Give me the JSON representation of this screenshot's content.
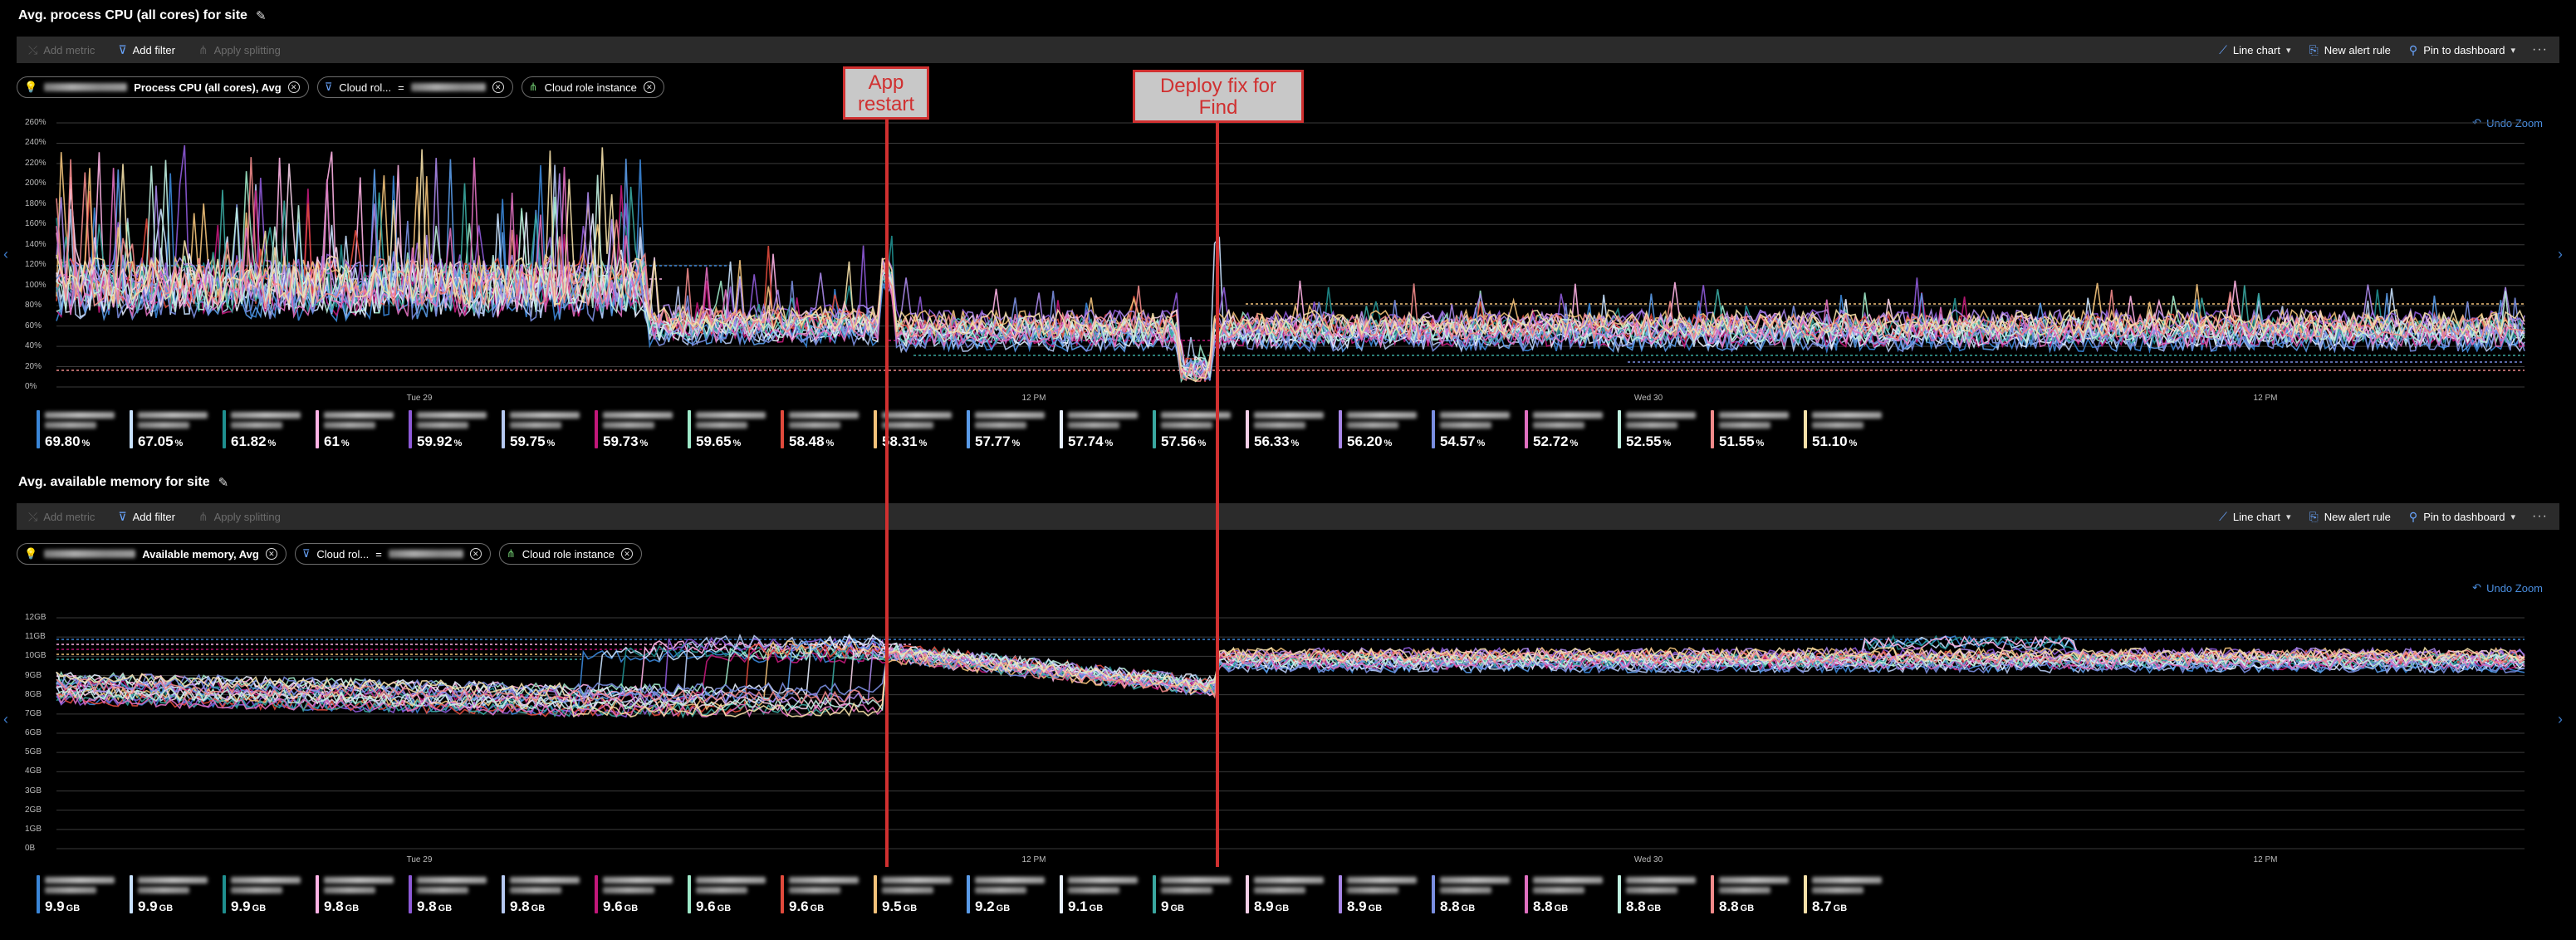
{
  "cpu_panel": {
    "title": "Avg. process CPU (all cores) for site",
    "toolbar": {
      "add_metric": "Add metric",
      "add_filter": "Add filter",
      "apply_splitting": "Apply splitting",
      "line_chart": "Line chart",
      "new_alert_rule": "New alert rule",
      "pin_to_dashboard": "Pin to dashboard",
      "more": "···"
    },
    "chips": {
      "metric_label": "Process CPU (all cores), Avg",
      "filter_label": "Cloud rol...",
      "filter_op": "=",
      "split_label": "Cloud role instance"
    },
    "undo_zoom": "Undo Zoom",
    "y_ticks": [
      "260%",
      "240%",
      "220%",
      "200%",
      "180%",
      "160%",
      "140%",
      "120%",
      "100%",
      "80%",
      "60%",
      "40%",
      "20%",
      "0%"
    ],
    "x_ticks": [
      "Tue 29",
      "12 PM",
      "Wed 30",
      "12 PM"
    ],
    "legend_values": [
      "69.80",
      "67.05",
      "61.82",
      "61",
      "59.92",
      "59.75",
      "59.73",
      "59.65",
      "58.48",
      "58.31",
      "57.77",
      "57.74",
      "57.56",
      "56.33",
      "56.20",
      "54.57",
      "52.72",
      "52.55",
      "51.55",
      "51.10"
    ],
    "legend_unit": "%"
  },
  "mem_panel": {
    "title": "Avg. available memory for site",
    "toolbar": {
      "add_metric": "Add metric",
      "add_filter": "Add filter",
      "apply_splitting": "Apply splitting",
      "line_chart": "Line chart",
      "new_alert_rule": "New alert rule",
      "pin_to_dashboard": "Pin to dashboard",
      "more": "···"
    },
    "chips": {
      "metric_label": "Available memory, Avg",
      "filter_label": "Cloud rol...",
      "filter_op": "=",
      "split_label": "Cloud role instance"
    },
    "undo_zoom": "Undo Zoom",
    "y_ticks": [
      "12GB",
      "11GB",
      "10GB",
      "9GB",
      "8GB",
      "7GB",
      "6GB",
      "5GB",
      "4GB",
      "3GB",
      "2GB",
      "1GB",
      "0B"
    ],
    "x_ticks": [
      "Tue 29",
      "12 PM",
      "Wed 30",
      "12 PM"
    ],
    "legend_values": [
      "9.9",
      "9.9",
      "9.9",
      "9.8",
      "9.8",
      "9.8",
      "9.6",
      "9.6",
      "9.6",
      "9.5",
      "9.2",
      "9.1",
      "9",
      "8.9",
      "8.9",
      "8.8",
      "8.8",
      "8.8",
      "8.8",
      "8.7"
    ],
    "legend_unit": "GB"
  },
  "series_colors": [
    "#3a86d8",
    "#c9e2ff",
    "#1f8f8f",
    "#ffb3e6",
    "#8e5ad8",
    "#b5c8f0",
    "#c2187a",
    "#9ee8c8",
    "#e04a3c",
    "#f2c27a",
    "#5a9be8",
    "#e8f0ff",
    "#3aa7a0",
    "#f5d0e8",
    "#a987e8",
    "#7a8ee0",
    "#e070c0",
    "#c0f0e0",
    "#f08a8a",
    "#f5e0a8"
  ],
  "annotations": {
    "restart": [
      "App",
      "restart"
    ],
    "deploy": [
      "Deploy fix for",
      "Find"
    ]
  }
}
